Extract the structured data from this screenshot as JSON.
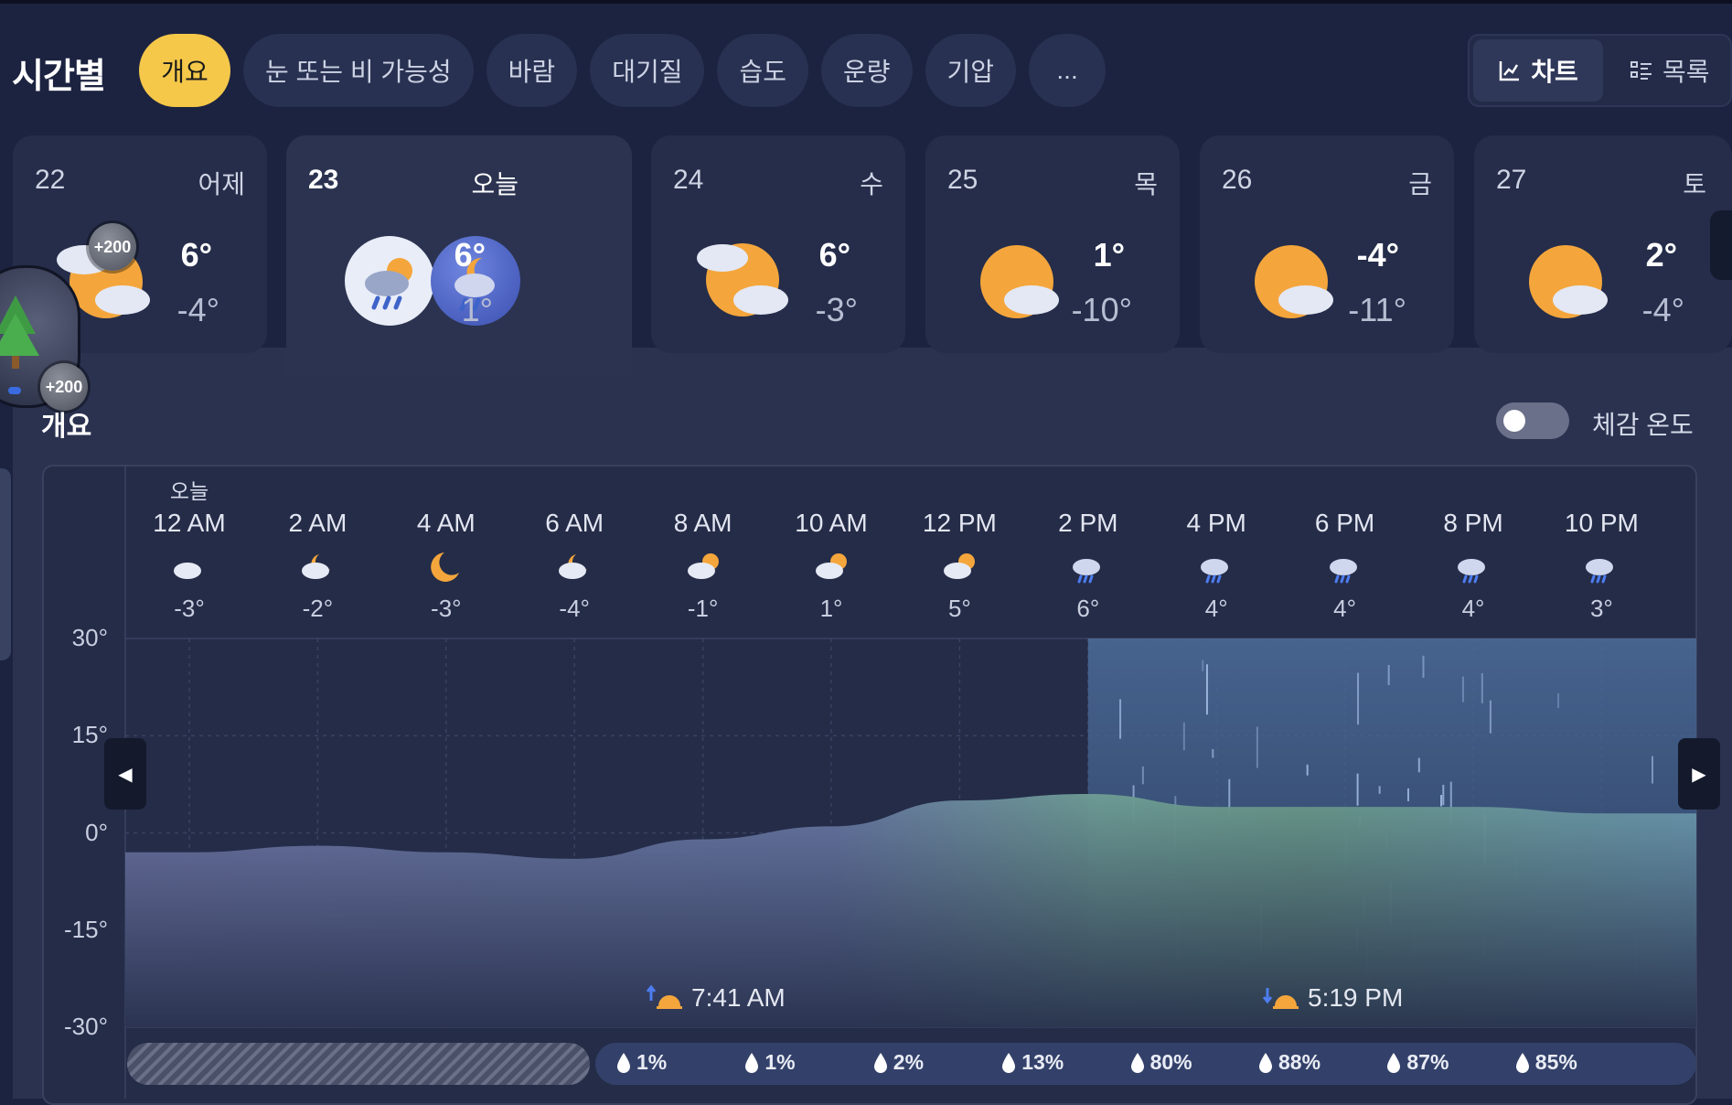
{
  "header": {
    "title": "시간별",
    "tabs": [
      {
        "label": "개요",
        "active": true
      },
      {
        "label": "눈 또는 비 가능성"
      },
      {
        "label": "바람"
      },
      {
        "label": "대기질"
      },
      {
        "label": "습도"
      },
      {
        "label": "운량"
      },
      {
        "label": "기압"
      },
      {
        "label": "..."
      }
    ],
    "view_toggle": {
      "chart_label": "차트",
      "list_label": "목록",
      "selected": "chart"
    }
  },
  "badges": {
    "top": "+200",
    "side": "+200"
  },
  "days": [
    {
      "num": "22",
      "label": "어제",
      "hi": "6°",
      "lo": "-4°",
      "icon": "partly-cloudy-icon"
    },
    {
      "num": "23",
      "label": "오늘",
      "hi": "6°",
      "lo": "1°",
      "icon": "rain-icon",
      "active": true
    },
    {
      "num": "24",
      "label": "수",
      "hi": "6°",
      "lo": "-3°",
      "icon": "partly-cloudy-icon"
    },
    {
      "num": "25",
      "label": "목",
      "hi": "1°",
      "lo": "-10°",
      "icon": "partly-sunny-icon"
    },
    {
      "num": "26",
      "label": "금",
      "hi": "-4°",
      "lo": "-11°",
      "icon": "partly-sunny-icon"
    },
    {
      "num": "27",
      "label": "토",
      "hi": "2°",
      "lo": "-4°",
      "icon": "partly-sunny-icon"
    }
  ],
  "section": {
    "title": "개요",
    "feels_like_label": "체감 온도",
    "feels_like_on": false
  },
  "hourly": {
    "day_caption": "오늘",
    "items": [
      {
        "time": "12 AM",
        "temp": "-3°",
        "icon": "cloudy-icon"
      },
      {
        "time": "2 AM",
        "temp": "-2°",
        "icon": "partly-cloudy-night-icon"
      },
      {
        "time": "4 AM",
        "temp": "-3°",
        "icon": "moon-icon"
      },
      {
        "time": "6 AM",
        "temp": "-4°",
        "icon": "partly-cloudy-night-icon"
      },
      {
        "time": "8 AM",
        "temp": "-1°",
        "icon": "partly-cloudy-day-icon"
      },
      {
        "time": "10 AM",
        "temp": "1°",
        "icon": "partly-cloudy-day-icon"
      },
      {
        "time": "12 PM",
        "temp": "5°",
        "icon": "partly-cloudy-day-icon"
      },
      {
        "time": "2 PM",
        "temp": "6°",
        "icon": "rain-icon"
      },
      {
        "time": "4 PM",
        "temp": "4°",
        "icon": "rain-icon"
      },
      {
        "time": "6 PM",
        "temp": "4°",
        "icon": "rain-icon"
      },
      {
        "time": "8 PM",
        "temp": "4°",
        "icon": "rain-icon"
      },
      {
        "time": "10 PM",
        "temp": "3°",
        "icon": "rain-icon"
      }
    ],
    "sunrise": "7:41 AM",
    "sunset": "5:19 PM",
    "precip": [
      "1%",
      "1%",
      "2%",
      "13%",
      "80%",
      "88%",
      "87%",
      "85%"
    ]
  },
  "chart_data": {
    "type": "area",
    "x": [
      "12 AM",
      "2 AM",
      "4 AM",
      "6 AM",
      "8 AM",
      "10 AM",
      "12 PM",
      "2 PM",
      "4 PM",
      "6 PM",
      "8 PM",
      "10 PM"
    ],
    "series": [
      {
        "values": [
          -3,
          -2,
          -3,
          -4,
          -1,
          1,
          5,
          6,
          4,
          4,
          4,
          3
        ]
      }
    ],
    "yticks": [
      "30°",
      "15°",
      "0°",
      "-15°",
      "-30°"
    ],
    "ylim": [
      -30,
      30
    ],
    "grid": true
  },
  "colors": {
    "accent": "#f5c84a",
    "background": "#1c2340",
    "card": "#252d4a",
    "precip_bar": "#33416a"
  }
}
